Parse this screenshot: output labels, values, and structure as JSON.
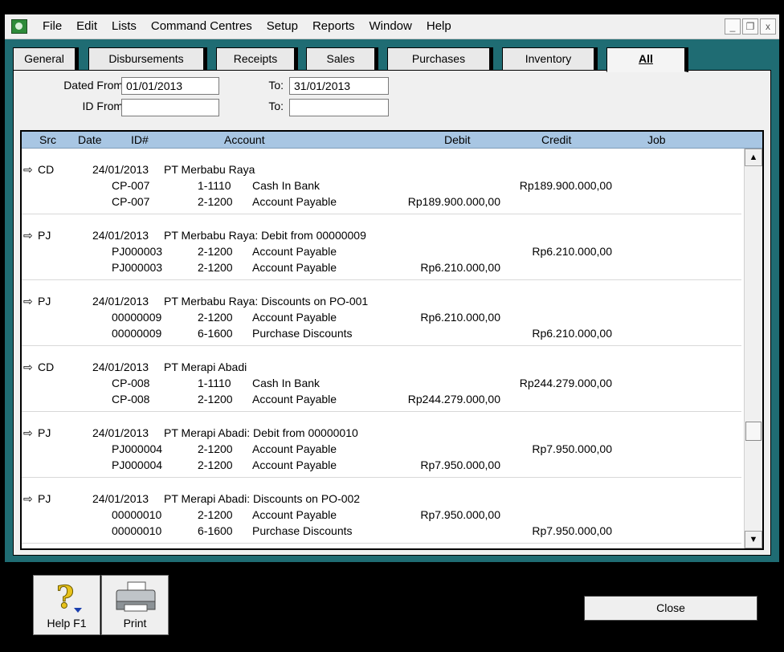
{
  "menu": [
    "File",
    "Edit",
    "Lists",
    "Command Centres",
    "Setup",
    "Reports",
    "Window",
    "Help"
  ],
  "window_buttons": {
    "minimize": "_",
    "restore": "❐",
    "close": "x"
  },
  "tabs": [
    {
      "label": "General"
    },
    {
      "label": "Disbursements"
    },
    {
      "label": "Receipts"
    },
    {
      "label": "Sales"
    },
    {
      "label": "Purchases"
    },
    {
      "label": "Inventory"
    },
    {
      "label": "All",
      "active": true
    }
  ],
  "filters": {
    "dated_from_label": "Dated From:",
    "dated_from_value": "01/01/2013",
    "dated_to_label": "To:",
    "dated_to_value": "31/01/2013",
    "id_from_label": "ID From:",
    "id_from_value": "",
    "id_to_label": "To:",
    "id_to_value": ""
  },
  "columns": {
    "src": "Src",
    "date": "Date",
    "id": "ID#",
    "account": "Account",
    "debit": "Debit",
    "credit": "Credit",
    "job": "Job"
  },
  "entries": [
    {
      "arrow": "⇨",
      "src": "CD",
      "date": "24/01/2013",
      "desc": "PT Merbabu Raya",
      "lines": [
        {
          "id": "CP-007",
          "acc": "1-1110",
          "name": "Cash In Bank",
          "debit": "",
          "credit": "Rp189.900.000,00"
        },
        {
          "id": "CP-007",
          "acc": "2-1200",
          "name": "Account Payable",
          "debit": "Rp189.900.000,00",
          "credit": ""
        }
      ]
    },
    {
      "arrow": "⇨",
      "src": "PJ",
      "date": "24/01/2013",
      "desc": "PT Merbabu Raya:  Debit from 00000009",
      "lines": [
        {
          "id": "PJ000003",
          "acc": "2-1200",
          "name": "Account Payable",
          "debit": "",
          "credit": "Rp6.210.000,00"
        },
        {
          "id": "PJ000003",
          "acc": "2-1200",
          "name": "Account Payable",
          "debit": "Rp6.210.000,00",
          "credit": ""
        }
      ]
    },
    {
      "arrow": "⇨",
      "src": "PJ",
      "date": "24/01/2013",
      "desc": "PT Merbabu Raya:  Discounts on PO-001",
      "lines": [
        {
          "id": "00000009",
          "acc": "2-1200",
          "name": "Account Payable",
          "debit": "Rp6.210.000,00",
          "credit": ""
        },
        {
          "id": "00000009",
          "acc": "6-1600",
          "name": "Purchase Discounts",
          "debit": "",
          "credit": "Rp6.210.000,00"
        }
      ]
    },
    {
      "arrow": "⇨",
      "src": "CD",
      "date": "24/01/2013",
      "desc": "PT Merapi Abadi",
      "lines": [
        {
          "id": "CP-008",
          "acc": "1-1110",
          "name": "Cash In Bank",
          "debit": "",
          "credit": "Rp244.279.000,00"
        },
        {
          "id": "CP-008",
          "acc": "2-1200",
          "name": "Account Payable",
          "debit": "Rp244.279.000,00",
          "credit": ""
        }
      ]
    },
    {
      "arrow": "⇨",
      "src": "PJ",
      "date": "24/01/2013",
      "desc": "PT Merapi Abadi:  Debit from 00000010",
      "lines": [
        {
          "id": "PJ000004",
          "acc": "2-1200",
          "name": "Account Payable",
          "debit": "",
          "credit": "Rp7.950.000,00"
        },
        {
          "id": "PJ000004",
          "acc": "2-1200",
          "name": "Account Payable",
          "debit": "Rp7.950.000,00",
          "credit": ""
        }
      ]
    },
    {
      "arrow": "⇨",
      "src": "PJ",
      "date": "24/01/2013",
      "desc": "PT Merapi Abadi:  Discounts on PO-002",
      "lines": [
        {
          "id": "00000010",
          "acc": "2-1200",
          "name": "Account Payable",
          "debit": "Rp7.950.000,00",
          "credit": ""
        },
        {
          "id": "00000010",
          "acc": "6-1600",
          "name": "Purchase Discounts",
          "debit": "",
          "credit": "Rp7.950.000,00"
        }
      ]
    }
  ],
  "scroll_arrows": {
    "up": "▲",
    "down": "▼"
  },
  "buttons": {
    "help": "Help F1",
    "print": "Print",
    "close": "Close"
  },
  "colors": {
    "frame": "#1f6c73",
    "header": "#a8c6e3",
    "background": "#000000"
  },
  "icons": {
    "help": "question-mark-icon",
    "print": "printer-icon",
    "app": "app-icon",
    "row_arrow": "right-arrow-icon"
  }
}
